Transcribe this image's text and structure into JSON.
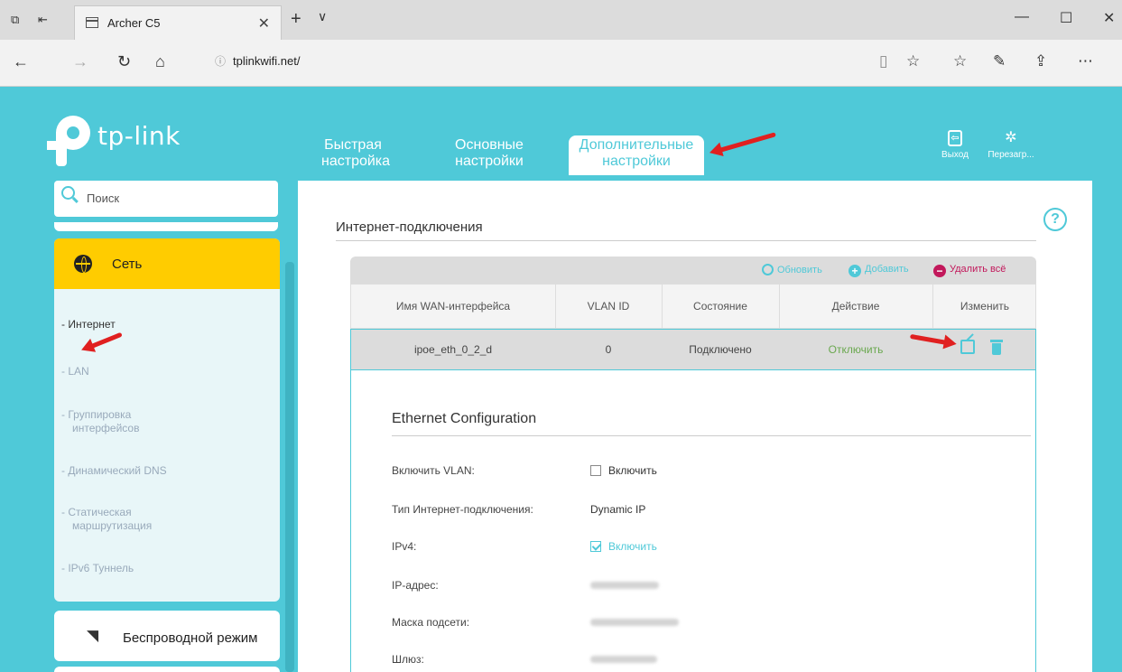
{
  "browser": {
    "tab_title": "Archer C5",
    "url": "tplinkwifi.net/",
    "new_tab_symbol": "+",
    "tab_list_symbol": "∨",
    "close_tab_symbol": "✕"
  },
  "header": {
    "logo_text": "tp-link",
    "nav": [
      {
        "line1": "Быстрая",
        "line2": "настройка"
      },
      {
        "line1": "Основные",
        "line2": "настройки"
      },
      {
        "line1": "Дополнительные",
        "line2": "настройки"
      }
    ],
    "logout_label": "Выход",
    "reboot_label": "Перезагр..."
  },
  "sidebar": {
    "search_placeholder": "Поиск",
    "section_label": "Сеть",
    "items": [
      {
        "label": "- Интернет"
      },
      {
        "label": "- LAN"
      },
      {
        "label": "- Группировка",
        "label2": "интерфейсов"
      },
      {
        "label": "- Динамический DNS"
      },
      {
        "label": "- Статическая",
        "label2": "маршрутизация"
      },
      {
        "label": "- IPv6 Туннель"
      }
    ],
    "wireless_label": "Беспроводной режим"
  },
  "main": {
    "section_title": "Интернет-подключения",
    "toolbar": {
      "refresh": "Обновить",
      "add": "Добавить",
      "delete_all": "Удалить всё"
    },
    "table": {
      "headers": [
        "Имя WAN-интерфейса",
        "VLAN ID",
        "Состояние",
        "Действие",
        "Изменить"
      ],
      "row": {
        "name": "ipoe_eth_0_2_d",
        "vlan": "0",
        "status": "Подключено",
        "action": "Отключить"
      }
    },
    "ethernet": {
      "title": "Ethernet Configuration",
      "fields": {
        "vlan_label": "Включить VLAN:",
        "vlan_value": "Включить",
        "conn_type_label": "Тип Интернет-подключения:",
        "conn_type_value": "Dynamic IP",
        "ipv4_label": "IPv4:",
        "ipv4_value": "Включить",
        "ip_label": "IP-адрес:",
        "mask_label": "Маска подсети:",
        "gateway_label": "Шлюз:"
      }
    }
  },
  "colors": {
    "brand_teal": "#4fc9d8",
    "active_yellow": "#ffcc00",
    "annotation_red": "#e02020",
    "delete_magenta": "#c2185b",
    "action_green": "#6aa84f"
  }
}
